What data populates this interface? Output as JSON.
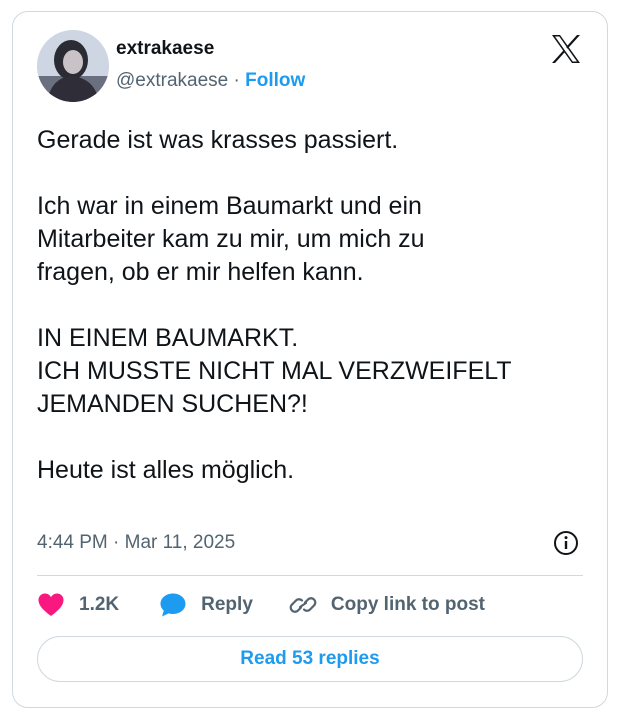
{
  "author": {
    "display_name": "extrakaese",
    "handle": "@extrakaese",
    "separator": " · ",
    "follow_label": "Follow"
  },
  "tweet": {
    "text": "Gerade ist was krasses passiert.\n\nIch war in einem Baumarkt und ein\nMitarbeiter kam zu mir, um mich zu\nfragen, ob er mir helfen kann.\n\nIN EINEM BAUMARKT.\nICH MUSSTE NICHT MAL VERZWEIFELT\nJEMANDEN SUCHEN?!\n\nHeute ist alles möglich.",
    "timestamp": "4:44 PM · Mar 11, 2025"
  },
  "actions": {
    "likes_count": "1.2K",
    "reply_label": "Reply",
    "copy_link_label": "Copy link to post",
    "read_replies_label": "Read 53 replies"
  },
  "icons": {
    "brand": "x-logo-icon",
    "info": "info-icon",
    "like": "heart-icon",
    "reply": "speech-bubble-icon",
    "copy": "link-icon"
  },
  "colors": {
    "accent": "#1d9bf0",
    "like": "#f91880",
    "text": "#0f1419",
    "muted": "#536471",
    "border": "#cfd9de"
  }
}
